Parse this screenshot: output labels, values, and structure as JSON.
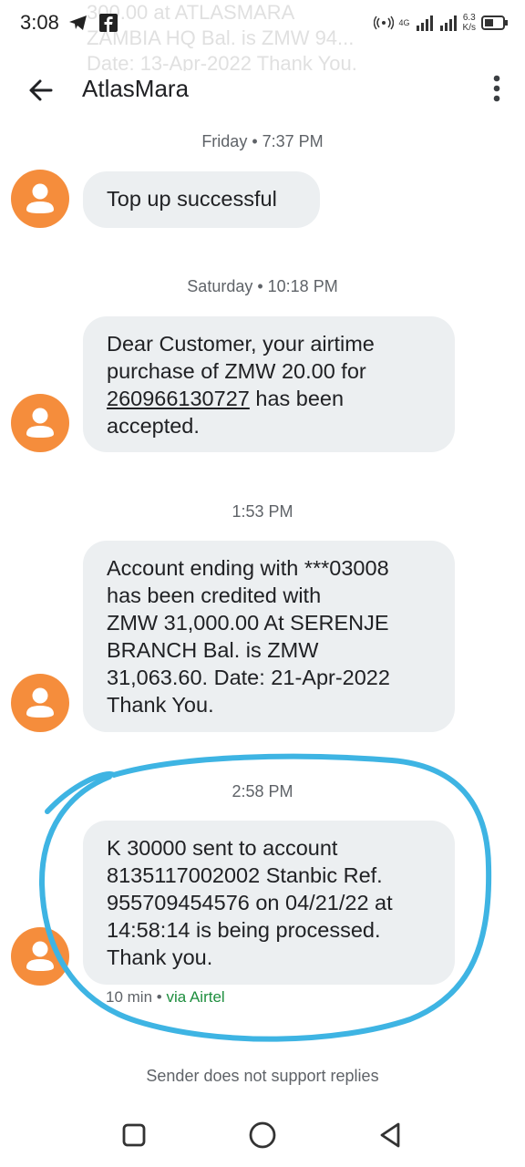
{
  "status_bar": {
    "time": "3:08",
    "network_label": "4G",
    "speed_value": "6.3",
    "speed_unit": "K/s"
  },
  "ghost_notification": {
    "line1": "300.00 at ATLASMARA",
    "line2": "ZAMBIA HQ Bal. is ZMW 94...",
    "line3": "Date: 13-Apr-2022 Thank You."
  },
  "header": {
    "title": "AtlasMara"
  },
  "conversation": {
    "stamp1": "Friday • 7:37 PM",
    "msg1": "Top up successful",
    "stamp2": "Saturday • 10:18 PM",
    "msg2_line1": "Dear Customer, your airtime",
    "msg2_line2": "purchase of ZMW 20.00 for",
    "msg2_link": "260966130727",
    "msg2_line3_rest": " has been",
    "msg2_line4": "accepted.",
    "stamp3": "1:53 PM",
    "msg3_line1": "Account ending with ***03008",
    "msg3_line2": "has been credited with",
    "msg3_line3": "ZMW 31,000.00 At SERENJE",
    "msg3_line4": "BRANCH Bal. is ZMW",
    "msg3_line5": "31,063.60. Date: 21-Apr-2022",
    "msg3_line6": "Thank You.",
    "stamp4": "2:58 PM",
    "msg4_line1": "K 30000 sent to account",
    "msg4_line2": "8135117002002 Stanbic Ref.",
    "msg4_line3": "955709454576 on 04/21/22 at",
    "msg4_line4": "14:58:14 is being processed.",
    "msg4_line5": "Thank you.",
    "meta_time": "10 min",
    "meta_sep": " • ",
    "meta_via": "via Airtel",
    "footer": "Sender does not support replies"
  },
  "colors": {
    "avatar": "#f58d3c",
    "bubble": "#eceff1",
    "annotation": "#3eb4e3"
  },
  "icons": {
    "back": "arrow-left-icon",
    "more": "more-vertical-icon",
    "avatar": "person-icon",
    "nav_recents": "square-icon",
    "nav_home": "circle-icon",
    "nav_back": "triangle-back-icon"
  }
}
